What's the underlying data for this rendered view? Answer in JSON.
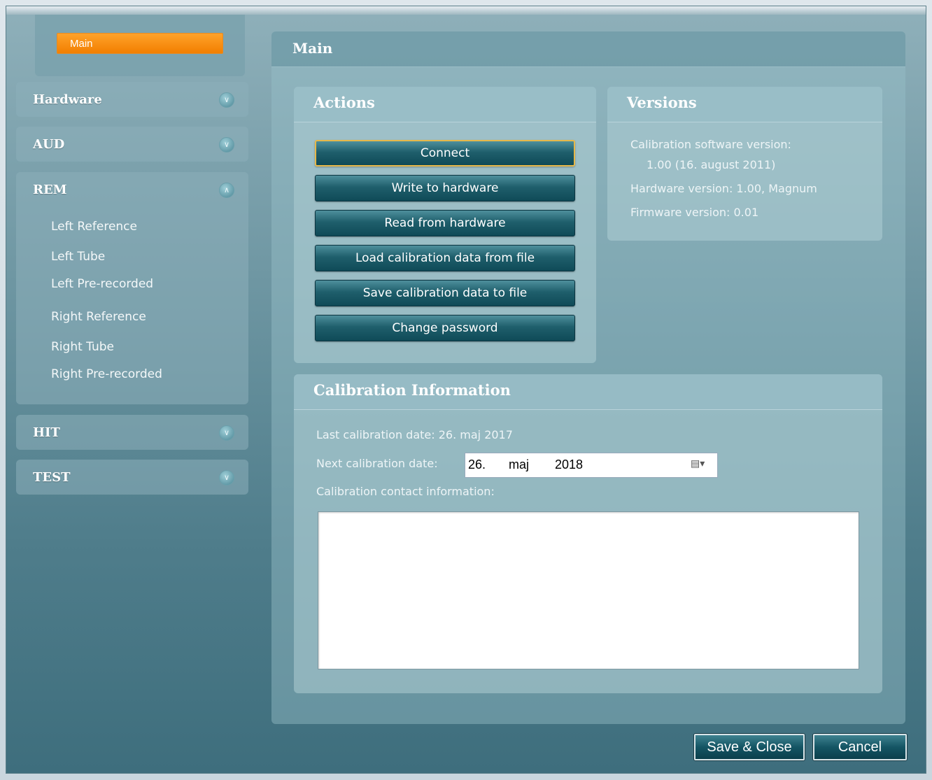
{
  "sidebar": {
    "main_tab": "Main",
    "sections": [
      {
        "title": "Hardware",
        "expanded": false,
        "items": []
      },
      {
        "title": "AUD",
        "expanded": false,
        "items": []
      },
      {
        "title": "REM",
        "expanded": true,
        "items": [
          "Left Reference",
          "Left Tube",
          "Left Pre-recorded",
          "Right Reference",
          "Right Tube",
          "Right Pre-recorded"
        ]
      },
      {
        "title": "HIT",
        "expanded": false,
        "items": []
      },
      {
        "title": "TEST",
        "expanded": false,
        "items": []
      }
    ],
    "icons": {
      "collapsed": "chevron-down-icon",
      "expanded": "chevron-up-icon"
    }
  },
  "main": {
    "title": "Main",
    "actions": {
      "title": "Actions",
      "buttons": [
        "Connect",
        "Write to hardware",
        "Read from hardware",
        "Load calibration data from file",
        "Save calibration data to file",
        "Change password"
      ]
    },
    "versions": {
      "title": "Versions",
      "calibration_software_label": "Calibration software version:",
      "calibration_software_value": "1.00  (16. august 2011)",
      "hardware_version": "Hardware version: 1.00, Magnum",
      "firmware_version": "Firmware version: 0.01"
    },
    "calibration": {
      "title": "Calibration Information",
      "last_date": "Last calibration date: 26. maj 2017",
      "next_date_label": "Next calibration date:",
      "next_date_day": "26.",
      "next_date_month": "maj",
      "next_date_year": "2018",
      "contact_label": "Calibration contact information:",
      "contact_value": ""
    }
  },
  "footer": {
    "save_close": "Save & Close",
    "cancel": "Cancel"
  },
  "colors": {
    "accent": "#f28a00",
    "button": "#1f5f6c"
  }
}
